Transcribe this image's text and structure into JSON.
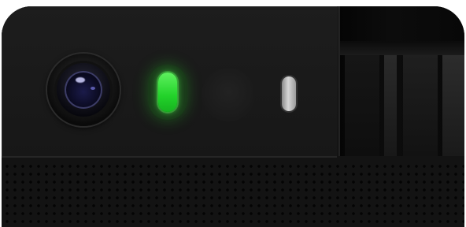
{
  "scene": {
    "subject": "",
    "colors": {
      "body": "#171717",
      "status_led": "#2ddc35",
      "indicator_led": "#c8c8c8",
      "lens": "#1b1b4a"
    }
  }
}
